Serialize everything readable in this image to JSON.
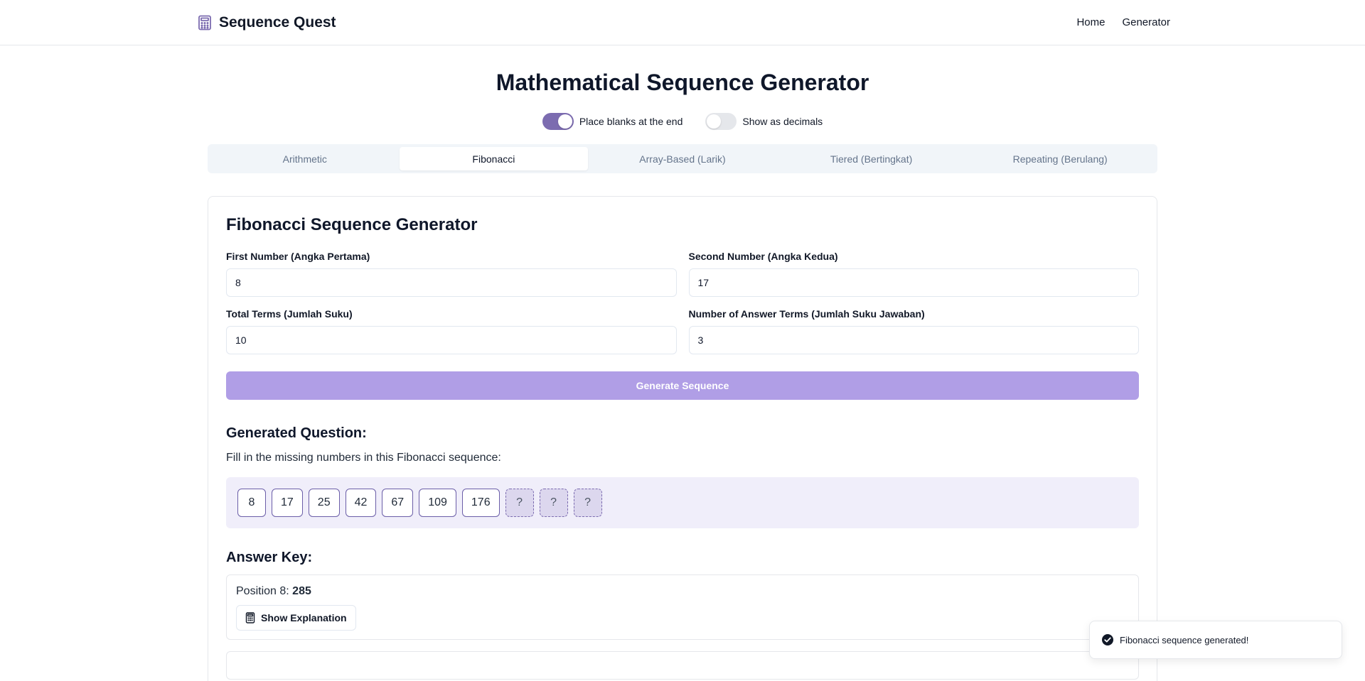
{
  "header": {
    "brand": "Sequence Quest",
    "brand_icon": "calculator-icon",
    "nav": {
      "home": "Home",
      "generator": "Generator"
    }
  },
  "main": {
    "title": "Mathematical Sequence Generator",
    "toggles": {
      "blanks_end": {
        "label": "Place blanks at the end",
        "on": true
      },
      "decimals": {
        "label": "Show as decimals",
        "on": false
      }
    },
    "tabs": [
      {
        "label": "Arithmetic",
        "active": false
      },
      {
        "label": "Fibonacci",
        "active": true
      },
      {
        "label": "Array-Based (Larik)",
        "active": false
      },
      {
        "label": "Tiered (Bertingkat)",
        "active": false
      },
      {
        "label": "Repeating (Berulang)",
        "active": false
      }
    ]
  },
  "card": {
    "title": "Fibonacci Sequence Generator",
    "fields": {
      "first": {
        "label": "First Number (Angka Pertama)",
        "value": "8"
      },
      "second": {
        "label": "Second Number (Angka Kedua)",
        "value": "17"
      },
      "total": {
        "label": "Total Terms (Jumlah Suku)",
        "value": "10"
      },
      "answers": {
        "label": "Number of Answer Terms (Jumlah Suku Jawaban)",
        "value": "3"
      }
    },
    "generate_label": "Generate Sequence",
    "question": {
      "heading": "Generated Question:",
      "text": "Fill in the missing numbers in this Fibonacci sequence:",
      "terms": [
        "8",
        "17",
        "25",
        "42",
        "67",
        "109",
        "176",
        "?",
        "?",
        "?"
      ]
    },
    "answer_key": {
      "heading": "Answer Key:",
      "position_label": "Position 8:",
      "position_value": "285",
      "explain_label": "Show Explanation"
    }
  },
  "toast": {
    "message": "Fibonacci sequence generated!"
  },
  "colors": {
    "accent": "#7c6cb0",
    "button": "#b09ee6",
    "sequence_bg": "#f0eefa"
  }
}
